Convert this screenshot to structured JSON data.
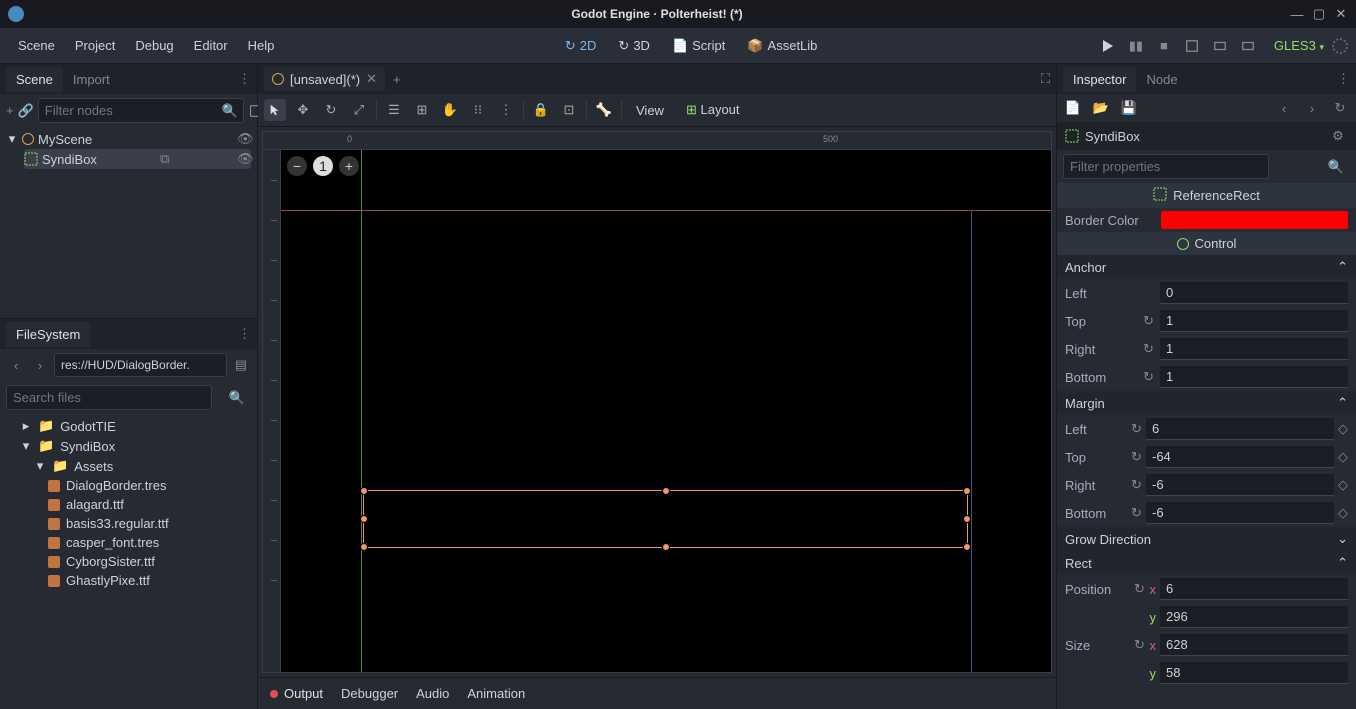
{
  "window": {
    "title": "Godot Engine · Polterheist! (*)"
  },
  "menubar": {
    "items": [
      "Scene",
      "Project",
      "Debug",
      "Editor",
      "Help"
    ],
    "modes": {
      "d2": "2D",
      "d3": "3D",
      "script": "Script",
      "assetlib": "AssetLib"
    },
    "renderer": "GLES3"
  },
  "scene_panel": {
    "tabs": {
      "scene": "Scene",
      "import": "Import"
    },
    "filter_placeholder": "Filter nodes",
    "root": "MyScene",
    "child": "SyndiBox"
  },
  "filesystem": {
    "title": "FileSystem",
    "path": "res://HUD/DialogBorder.",
    "search_placeholder": "Search files",
    "items": [
      {
        "name": "GodotTIE",
        "type": "folder",
        "indent": 1
      },
      {
        "name": "SyndiBox",
        "type": "folder",
        "indent": 1,
        "open": true
      },
      {
        "name": "Assets",
        "type": "folder",
        "indent": 2,
        "open": true
      },
      {
        "name": "DialogBorder.tres",
        "type": "file",
        "indent": 3
      },
      {
        "name": "alagard.ttf",
        "type": "file",
        "indent": 3
      },
      {
        "name": "basis33.regular.ttf",
        "type": "file",
        "indent": 3
      },
      {
        "name": "casper_font.tres",
        "type": "file",
        "indent": 3
      },
      {
        "name": "CyborgSister.ttf",
        "type": "file",
        "indent": 3
      },
      {
        "name": "GhastlyPixe.ttf",
        "type": "file",
        "indent": 3
      }
    ]
  },
  "editor": {
    "tab": "[unsaved](*)",
    "view_label": "View",
    "layout_label": "Layout",
    "ruler": {
      "a": "0",
      "b": "500"
    }
  },
  "bottom": {
    "output": "Output",
    "debugger": "Debugger",
    "audio": "Audio",
    "animation": "Animation"
  },
  "inspector": {
    "tabs": {
      "inspector": "Inspector",
      "node": "Node"
    },
    "node_name": "SyndiBox",
    "filter_placeholder": "Filter properties",
    "class_ref": "ReferenceRect",
    "border_color_label": "Border Color",
    "border_color": "#ff0000",
    "class_control": "Control",
    "groups": {
      "anchor": "Anchor",
      "margin": "Margin",
      "grow": "Grow Direction",
      "rect": "Rect"
    },
    "anchor": {
      "left_l": "Left",
      "left": "0",
      "top_l": "Top",
      "top": "1",
      "right_l": "Right",
      "right": "1",
      "bottom_l": "Bottom",
      "bottom": "1"
    },
    "margin": {
      "left_l": "Left",
      "left": "6",
      "top_l": "Top",
      "top": "-64",
      "right_l": "Right",
      "right": "-6",
      "bottom_l": "Bottom",
      "bottom": "-6"
    },
    "rect": {
      "position_l": "Position",
      "pos_x": "6",
      "pos_y": "296",
      "size_l": "Size",
      "size_x": "628",
      "size_y": "58"
    },
    "x": "x",
    "y": "y"
  }
}
